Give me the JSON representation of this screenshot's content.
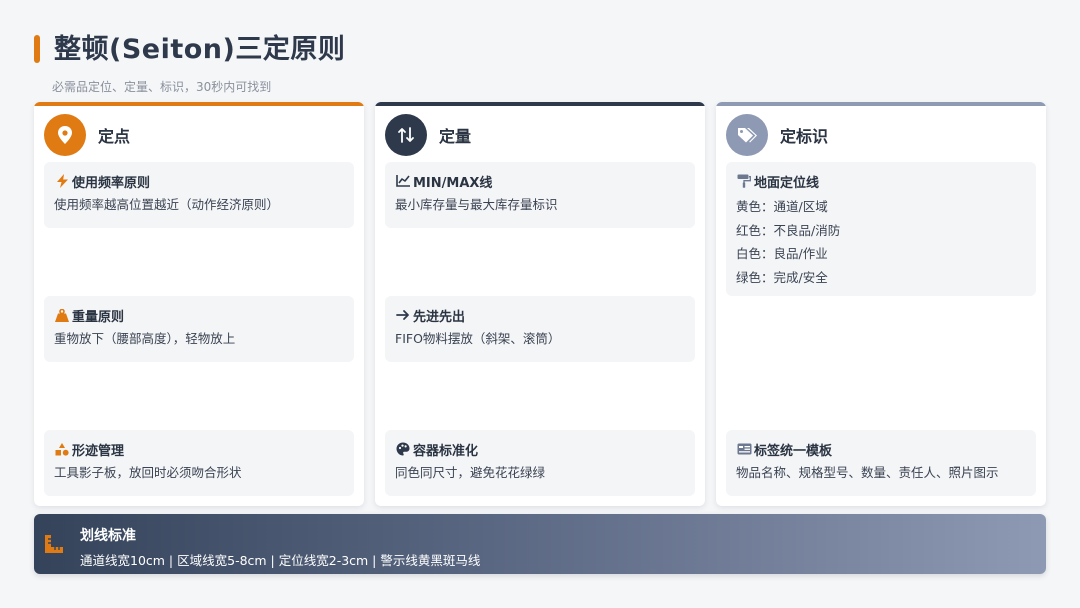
{
  "header": {
    "title": "整顿(Seiton)三定原则",
    "subtitle": "必需品定位、定量、标识，30秒内可找到"
  },
  "colors": {
    "orange": "#e07a12",
    "navy": "#2e3a4c",
    "slate": "#8e99b3"
  },
  "columns": [
    {
      "title": "定点",
      "icon": "map-pin-icon",
      "cards": [
        {
          "icon": "lightning-icon",
          "title": "使用频率原则",
          "text": "使用频率越高位置越近（动作经济原则）"
        },
        {
          "icon": "weight-icon",
          "title": "重量原则",
          "text": "重物放下（腰部高度），轻物放上"
        },
        {
          "icon": "shapes-icon",
          "title": "形迹管理",
          "text": "工具影子板，放回时必须吻合形状"
        }
      ]
    },
    {
      "title": "定量",
      "icon": "sort-arrows-icon",
      "cards": [
        {
          "icon": "line-chart-icon",
          "title": "MIN/MAX线",
          "text": "最小库存量与最大库存量标识"
        },
        {
          "icon": "arrow-right-icon",
          "title": "先进先出",
          "text": "FIFO物料摆放（斜架、滚筒）"
        },
        {
          "icon": "palette-icon",
          "title": "容器标准化",
          "text": "同色同尺寸，避免花花绿绿"
        }
      ]
    },
    {
      "title": "定标识",
      "icon": "tags-icon",
      "cards": [
        {
          "icon": "paint-roller-icon",
          "title": "地面定位线",
          "lines": [
            "黄色：通道/区域",
            "红色：不良品/消防",
            "白色：良品/作业",
            "绿色：完成/安全"
          ]
        },
        {
          "icon": "id-card-icon",
          "title": "标签统一模板",
          "text": "物品名称、规格型号、数量、责任人、照片图示"
        }
      ]
    }
  ],
  "footer": {
    "icon": "ruler-icon",
    "title": "划线标准",
    "text": "通道线宽10cm | 区域线宽5-8cm | 定位线宽2-3cm | 警示线黄黑斑马线"
  }
}
